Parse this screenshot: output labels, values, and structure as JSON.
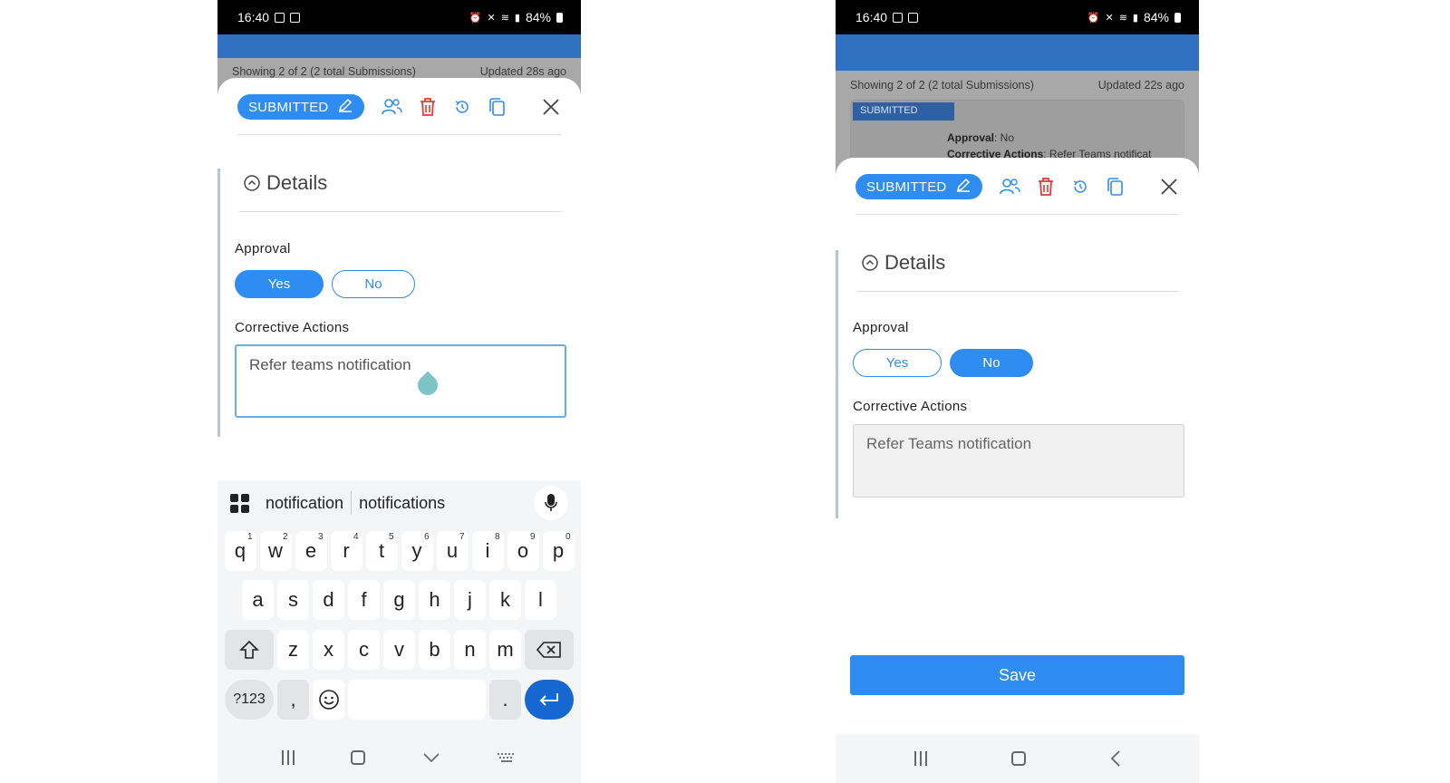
{
  "colors": {
    "accent": "#2f8cf0",
    "header_blue": "#2f70c0",
    "delete_red": "#e53935"
  },
  "status_bar": {
    "time": "16:40",
    "battery": "84%"
  },
  "left_screen": {
    "summary": {
      "showing": "Showing 2 of 2 (2 total Submissions)",
      "updated": "Updated 28s ago"
    },
    "status_pill": "SUBMITTED",
    "details_title": "Details",
    "approval_label": "Approval",
    "approval_options": {
      "yes": "Yes",
      "no": "No",
      "selected": "Yes"
    },
    "corrective_label": "Corrective Actions",
    "corrective_value": "Refer teams notification",
    "keyboard": {
      "suggestions": [
        "notification",
        "notifications"
      ],
      "row1": [
        "q",
        "w",
        "e",
        "r",
        "t",
        "y",
        "u",
        "i",
        "o",
        "p"
      ],
      "row1_numbers": [
        "1",
        "2",
        "3",
        "4",
        "5",
        "6",
        "7",
        "8",
        "9",
        "0"
      ],
      "row2": [
        "a",
        "s",
        "d",
        "f",
        "g",
        "h",
        "j",
        "k",
        "l"
      ],
      "row3": [
        "z",
        "x",
        "c",
        "v",
        "b",
        "n",
        "m"
      ],
      "symbols_key": "?123",
      "comma_key": ",",
      "period_key": "."
    }
  },
  "right_screen": {
    "summary": {
      "showing": "Showing 2 of 2 (2 total Submissions)",
      "updated": "Updated 22s ago"
    },
    "underlay_badge": "SUBMITTED",
    "underlay_approval_label": "Approval",
    "underlay_approval_value": ": No",
    "underlay_corrective_label": "Corrective Actions",
    "underlay_corrective_value": ": Refer Teams notificat",
    "status_pill": "SUBMITTED",
    "details_title": "Details",
    "approval_label": "Approval",
    "approval_options": {
      "yes": "Yes",
      "no": "No",
      "selected": "No"
    },
    "corrective_label": "Corrective Actions",
    "corrective_value": "Refer Teams notification",
    "save_label": "Save"
  }
}
